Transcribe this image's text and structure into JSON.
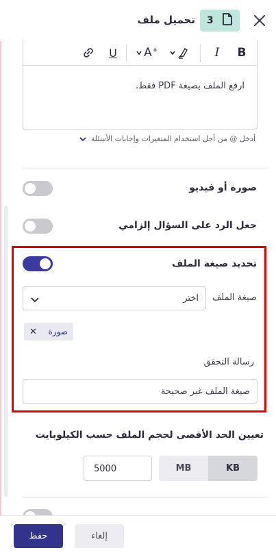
{
  "header": {
    "title": "تحميل ملف",
    "step_number": "3",
    "icons": {
      "close": "close-icon",
      "file": "file-icon"
    }
  },
  "editor": {
    "toolbar": {
      "bold": "B",
      "italic": "I",
      "font_size": "A",
      "underline": "U",
      "icons": [
        "bold-icon",
        "italic-icon",
        "highlight-color-icon",
        "font-color-icon",
        "underline-icon",
        "link-icon"
      ]
    },
    "content": "ارفع الملف بصيغة PDF فقط.",
    "hint": "أدخل @ من أجل استخدام المتغيرات وإجابات الأسئلة"
  },
  "settings": {
    "media": {
      "label": "صورة أو فيديو",
      "enabled": false
    },
    "required": {
      "label": "جعل الرد على السؤال إلزامي",
      "enabled": false
    },
    "file_type": {
      "label": "تحديد صيغة الملف",
      "enabled": true,
      "format_label": "صيغة الملف",
      "select_placeholder": "اختر",
      "selected_chips": [
        "صورة"
      ],
      "validation_label": "رسالة التحقق",
      "validation_message": "صيغة الملف غير صحيحة"
    },
    "max_size": {
      "label": "تعيين الحد الأقصى لحجم الملف حسب الكيلوبايت",
      "value": "5000",
      "units": [
        "KB",
        "MB"
      ],
      "selected_unit": "KB"
    }
  },
  "footer": {
    "save_label": "حفظ",
    "cancel_label": "إلغاء"
  },
  "colors": {
    "primary": "#33338c",
    "toggle_on": "#3b3aa0",
    "badge": "#bfe6dd",
    "highlight": "#e00000"
  }
}
